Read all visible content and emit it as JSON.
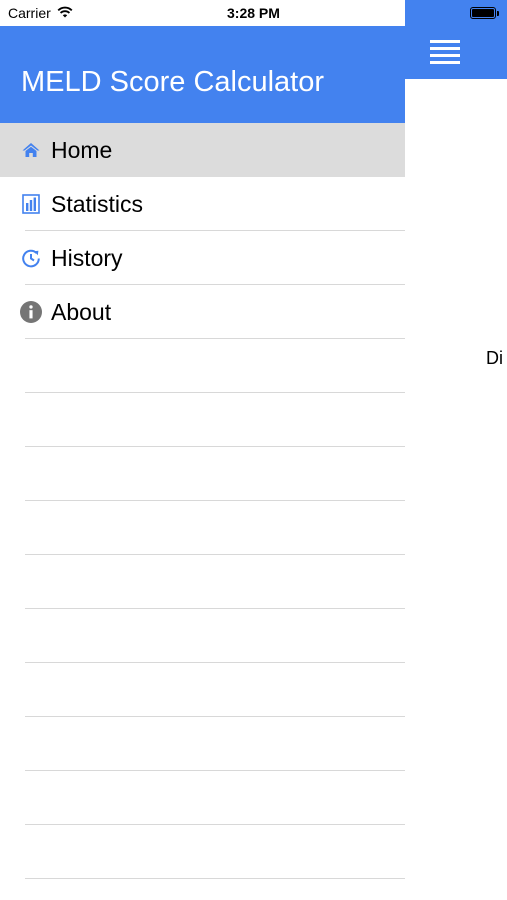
{
  "status_bar": {
    "carrier": "Carrier",
    "time": "3:28 PM"
  },
  "drawer": {
    "title": "MELD Score Calculator",
    "items": [
      {
        "label": "Home",
        "icon": "home-icon",
        "active": true
      },
      {
        "label": "Statistics",
        "icon": "statistics-icon",
        "active": false
      },
      {
        "label": "History",
        "icon": "history-icon",
        "active": false
      },
      {
        "label": "About",
        "icon": "info-icon",
        "active": false
      }
    ]
  },
  "main": {
    "peek_text": "Di"
  },
  "colors": {
    "accent": "#4382ef",
    "active_row": "#dcdcdc",
    "separator": "#d8d8d8",
    "about_icon": "#757575"
  }
}
